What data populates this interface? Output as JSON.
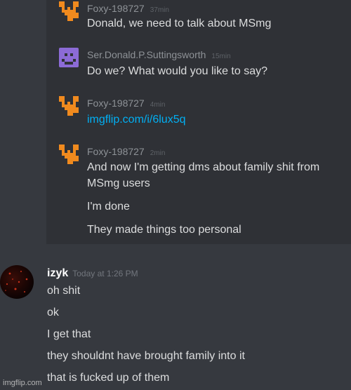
{
  "quoted": [
    {
      "user": "Foxy-198727",
      "time": "37min",
      "avatar": "orange-fox-icon",
      "lines": [
        "Donald, we need to talk about MSmg"
      ]
    },
    {
      "user": "Ser.Donald.P.Suttingsworth",
      "time": "15min",
      "avatar": "purple-smiley-icon",
      "lines": [
        "Do we? What would you like to say?"
      ]
    },
    {
      "user": "Foxy-198727",
      "time": "4min",
      "avatar": "orange-fox-icon",
      "link": "imgflip.com/i/6lux5q"
    },
    {
      "user": "Foxy-198727",
      "time": "2min",
      "avatar": "orange-fox-icon",
      "lines": [
        "And now I'm getting dms about family shit from",
        "MSmg users",
        "I'm done",
        "They made things too personal"
      ]
    }
  ],
  "main": {
    "author": "izyk",
    "timestamp": "Today at 1:26 PM",
    "avatar": "dark-red-avatar",
    "lines": [
      "oh shit",
      "ok",
      "I get that",
      "they shouldnt have brought family into it",
      "that is fucked up of them"
    ]
  },
  "watermark": "imgflip.com",
  "colors": {
    "background": "#36393f",
    "embed": "#2f3136",
    "link": "#00b0f4",
    "fox": "#f08a1e",
    "smiley": "#8c6bd6"
  }
}
